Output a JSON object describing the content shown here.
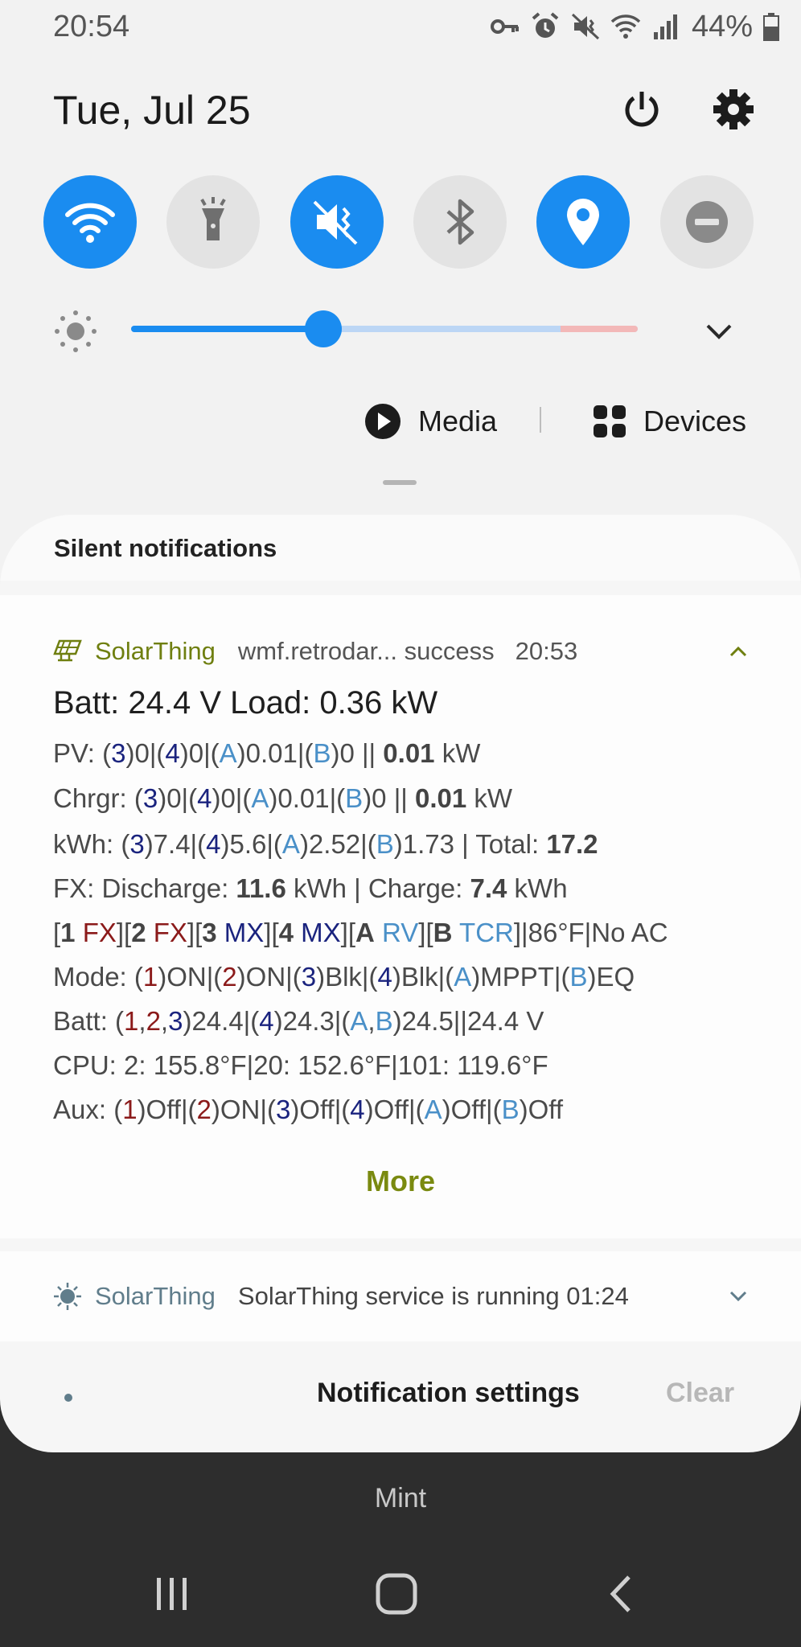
{
  "status_bar": {
    "time": "20:54",
    "battery_percent": "44%"
  },
  "header": {
    "date": "Tue, Jul 25"
  },
  "quick_toggles": [
    {
      "name": "wifi",
      "state": "on"
    },
    {
      "name": "flashlight",
      "state": "off"
    },
    {
      "name": "mute",
      "state": "on"
    },
    {
      "name": "bluetooth",
      "state": "off"
    },
    {
      "name": "location",
      "state": "on"
    },
    {
      "name": "do-not-disturb",
      "state": "off"
    }
  ],
  "brightness": {
    "level": 0.38
  },
  "media": {
    "media_label": "Media",
    "devices_label": "Devices"
  },
  "silent_section": {
    "title": "Silent notifications"
  },
  "notification1": {
    "app": "SolarThing",
    "meta": "wmf.retrodar... success",
    "time": "20:53",
    "title": "Batt: 24.4 V Load: 0.36 kW",
    "pv": {
      "p1": "PV: (",
      "n3": "3",
      "p2": ")0|(",
      "n4": "4",
      "p3": ")0|(",
      "nA": "A",
      "p4": ")0.01|(",
      "nB": "B",
      "p5": ")0 || ",
      "bold": "0.01",
      "p6": " kW"
    },
    "chrgr": {
      "p1": "Chrgr: (",
      "n3": "3",
      "p2": ")0|(",
      "n4": "4",
      "p3": ")0|(",
      "nA": "A",
      "p4": ")0.01|(",
      "nB": "B",
      "p5": ")0 || ",
      "bold": "0.01",
      "p6": " kW"
    },
    "kwh": {
      "p1": "kWh: (",
      "n3": "3",
      "p2": ")7.4|(",
      "n4": "4",
      "p3": ")5.6|(",
      "nA": "A",
      "p4": ")2.52|(",
      "nB": "B",
      "p5": ")1.73 | Total: ",
      "bold": "17.2"
    },
    "fx": {
      "p1": "FX: Discharge: ",
      "b1": "11.6",
      "p2": " kWh | Charge: ",
      "b2": "7.4",
      "p3": " kWh"
    },
    "devices": {
      "o1": "[",
      "d1": "1",
      "t1": "FX",
      "o2": "][",
      "d2": "2",
      "t2": "FX",
      "o3": "][",
      "d3": "3",
      "t3": "MX",
      "o4": "][",
      "d4": "4",
      "t4": "MX",
      "o5": "][",
      "d5": "A",
      "t5": "RV",
      "o6": "][",
      "d6": "B",
      "t6": "TCR",
      "rest": "]|86°F|No AC"
    },
    "mode": {
      "p1": "Mode: (",
      "n1": "1",
      "p2": ")ON|(",
      "n2": "2",
      "p3": ")ON|(",
      "n3": "3",
      "p4": ")Blk|(",
      "n4": "4",
      "p5": ")Blk|(",
      "nA": "A",
      "p6": ")MPPT|(",
      "nB": "B",
      "p7": ")EQ"
    },
    "batt": {
      "p1": "Batt: (",
      "n1": "1",
      "c1": ",",
      "n2": "2",
      "c2": ",",
      "n3": "3",
      "p2": ")24.4|(",
      "n4": "4",
      "p3": ")24.3|(",
      "nA": "A",
      "c3": ",",
      "nB": "B",
      "p4": ")24.5||24.4 V"
    },
    "cpu": "CPU: 2: 155.8°F|20: 152.6°F|101: 119.6°F",
    "aux": {
      "p1": "Aux: (",
      "n1": "1",
      "p2": ")Off|(",
      "n2": "2",
      "p3": ")ON|(",
      "n3": "3",
      "p4": ")Off|(",
      "n4": "4",
      "p5": ")Off|(",
      "nA": "A",
      "p6": ")Off|(",
      "nB": "B",
      "p7": ")Off"
    },
    "more_label": "More"
  },
  "notification2": {
    "app": "SolarThing",
    "text": "SolarThing service is running",
    "time": "01:24"
  },
  "footer": {
    "settings_label": "Notification settings",
    "clear_label": "Clear"
  },
  "carrier": "Mint",
  "colors": {
    "accent": "#1a8cf0",
    "app_green": "#6f7f10",
    "device_red": "#8b1a1a",
    "device_navy": "#1a237e",
    "device_blue": "#4a90c8"
  }
}
